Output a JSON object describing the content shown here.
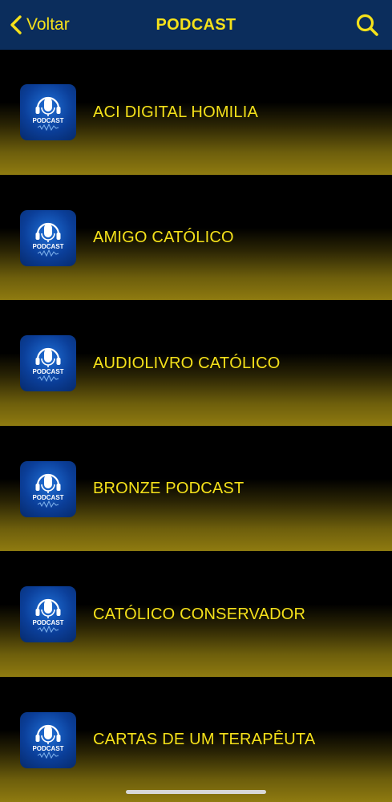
{
  "header": {
    "back_label": "Voltar",
    "title": "PODCAST"
  },
  "thumbnail": {
    "text": "PODCAST"
  },
  "items": [
    {
      "label": "ACI DIGITAL HOMILIA"
    },
    {
      "label": "AMIGO CATÓLICO"
    },
    {
      "label": "AUDIOLIVRO CATÓLICO"
    },
    {
      "label": "BRONZE PODCAST"
    },
    {
      "label": "CATÓLICO CONSERVADOR"
    },
    {
      "label": "CARTAS DE UM TERAPÊUTA"
    }
  ],
  "colors": {
    "header_bg": "#0b2d5c",
    "accent": "#f5e11a",
    "row_gradient_bottom": "#8f7b10",
    "thumb_blue": "#0b3f9a"
  }
}
